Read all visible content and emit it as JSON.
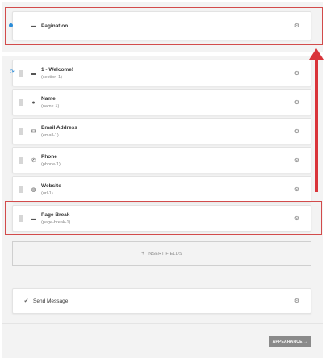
{
  "pagination": {
    "title": "Pagination"
  },
  "fields": [
    {
      "title": "1 - Welcome!",
      "id": "(section-1)",
      "icon": "section-icon"
    },
    {
      "title": "Name",
      "id": "(name-1)",
      "icon": "person-icon"
    },
    {
      "title": "Email Address",
      "id": "(email-1)",
      "icon": "envelope-icon"
    },
    {
      "title": "Phone",
      "id": "(phone-1)",
      "icon": "phone-icon"
    },
    {
      "title": "Website",
      "id": "(url-1)",
      "icon": "globe-icon"
    },
    {
      "title": "Page Break",
      "id": "(page-break-1)",
      "icon": "page-break-icon"
    }
  ],
  "insert_fields": {
    "label": "INSERT FIELDS",
    "plus": "+"
  },
  "send_message": {
    "title": "Send Message"
  },
  "footer": {
    "appearance_label": "APPEARANCE →"
  },
  "colors": {
    "highlight": "#d24b4b",
    "arrow": "#d9343a",
    "accent": "#2b8cd8"
  }
}
